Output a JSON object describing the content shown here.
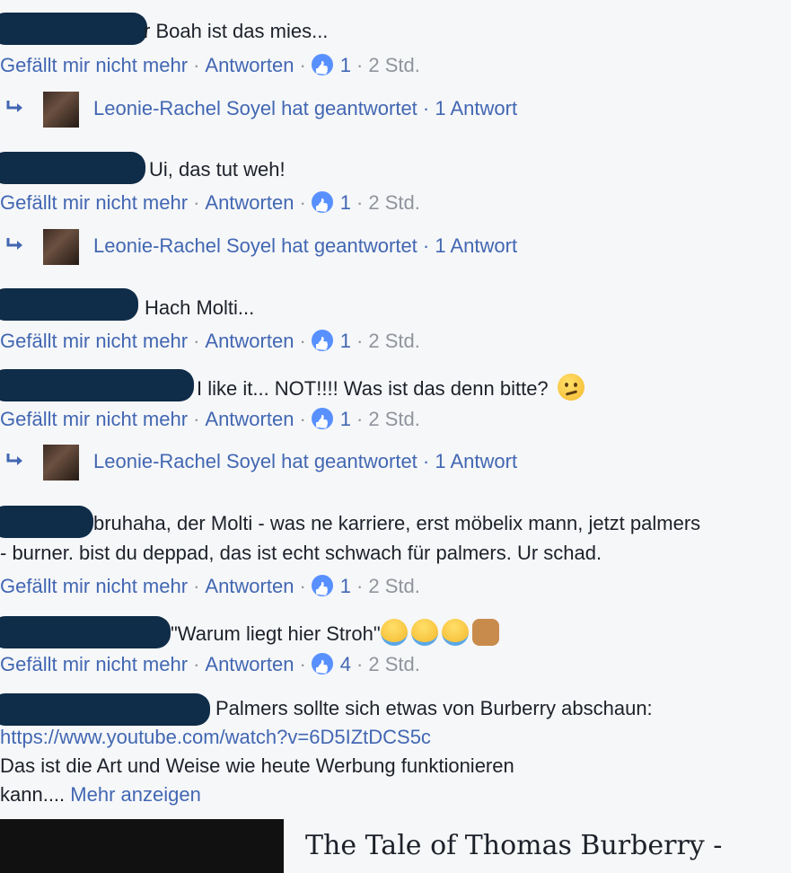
{
  "comments": [
    {
      "text": "r Boah ist das mies...",
      "actions": {
        "like": "Gefällt mir nicht mehr",
        "reply": "Antworten",
        "count": "1",
        "time": "2 Std."
      }
    },
    {
      "text": "Ui, das tut weh!",
      "actions": {
        "like": "Gefällt mir nicht mehr",
        "reply": "Antworten",
        "count": "1",
        "time": "2 Std."
      }
    },
    {
      "text": "Hach Molti...",
      "actions": {
        "like": "Gefällt mir nicht mehr",
        "reply": "Antworten",
        "count": "1",
        "time": "2 Std."
      }
    },
    {
      "text": "I like it... NOT!!!! Was ist das denn bitte?",
      "actions": {
        "like": "Gefällt mir nicht mehr",
        "reply": "Antworten",
        "count": "1",
        "time": "2 Std."
      }
    },
    {
      "text_line1": "bruhaha, der Molti - was ne karriere, erst möbelix mann, jetzt palmers",
      "text_line2": "- burner. bist du deppad, das ist echt schwach für palmers. Ur schad.",
      "actions": {
        "like": "Gefällt mir nicht mehr",
        "reply": "Antworten",
        "count": "1",
        "time": "2 Std."
      }
    },
    {
      "text": "\"Warum liegt hier Stroh\"",
      "actions": {
        "like": "Gefällt mir nicht mehr",
        "reply": "Antworten",
        "count": "4",
        "time": "2 Std."
      }
    },
    {
      "text_line1": "Palmers sollte sich etwas von Burberry abschaun:",
      "link": "https://www.youtube.com/watch?v=6D5IZtDCS5c",
      "text_line3": "Das ist die Art und Weise wie heute Werbung funktionieren",
      "text_line4": "kann....",
      "more": "Mehr anzeigen"
    }
  ],
  "reply_text": "Leonie-Rachel Soyel hat geantwortet · 1 Antwort",
  "link_preview": {
    "title": "The Tale of Thomas Burberry -"
  },
  "colors": {
    "link": "#4267b2",
    "meta": "#90949c",
    "redaction": "#0f2c48",
    "background": "#f6f7f9"
  }
}
